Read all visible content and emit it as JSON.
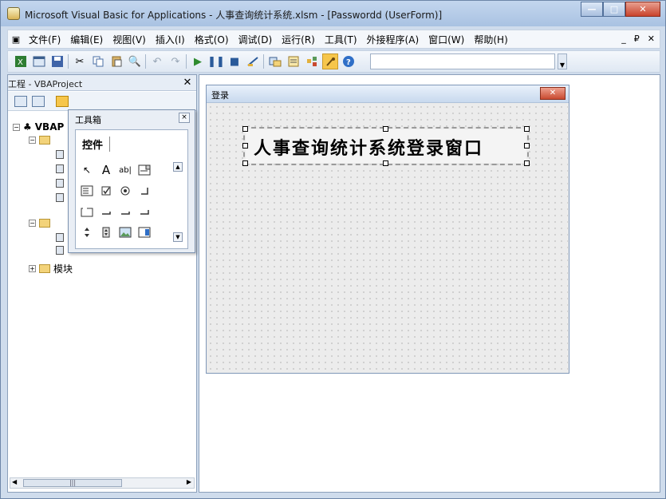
{
  "window": {
    "title": "Microsoft Visual Basic for Applications - 人事查询统计系统.xlsm - [Passwordd (UserForm)]",
    "controls": {
      "minimize": "—",
      "maximize": "□",
      "close": "✕"
    }
  },
  "menubar": {
    "items": [
      "文件(F)",
      "编辑(E)",
      "视图(V)",
      "插入(I)",
      "格式(O)",
      "调试(D)",
      "运行(R)",
      "工具(T)",
      "外接程序(A)",
      "窗口(W)",
      "帮助(H)"
    ],
    "right_controls": [
      "_",
      "₽",
      "✕"
    ]
  },
  "toolbar": {
    "icons": [
      "excel-icon",
      "insert-userform-icon",
      "save-icon",
      "cut-icon",
      "copy-icon",
      "paste-icon",
      "find-icon",
      "undo-icon",
      "redo-icon",
      "run-icon",
      "break-icon",
      "reset-icon",
      "design-mode-icon",
      "project-explorer-icon",
      "properties-icon",
      "object-browser-icon",
      "toolbox-icon",
      "help-icon"
    ],
    "input_value": ""
  },
  "project_pane": {
    "title": "工程 - VBAProject",
    "close": "✕",
    "tree": {
      "root": "VBAP",
      "modules_folder": "模块"
    },
    "scroll_thumb": "|||"
  },
  "toolbox": {
    "title": "工具箱",
    "close": "×",
    "tab": "控件",
    "controls": [
      "select-objects",
      "label",
      "textbox",
      "combobox",
      "listbox",
      "checkbox",
      "optionbutton",
      "togglebutton",
      "frame",
      "commandbutton",
      "tabstrip",
      "multipage",
      "scrollbar",
      "spinbutton",
      "image",
      "refedit"
    ],
    "glyphs": {
      "label": "A",
      "textbox": "ab|",
      "pointer": "↖"
    }
  },
  "userform": {
    "caption": "登录",
    "close": "✕",
    "label_text": "人事查询统计系统登录窗口"
  },
  "colors": {
    "titlebar": "#b6cbe8",
    "close_red": "#c9432c",
    "grid_dot": "#8d8d8d",
    "toolbox_active": "#f6c64b"
  }
}
